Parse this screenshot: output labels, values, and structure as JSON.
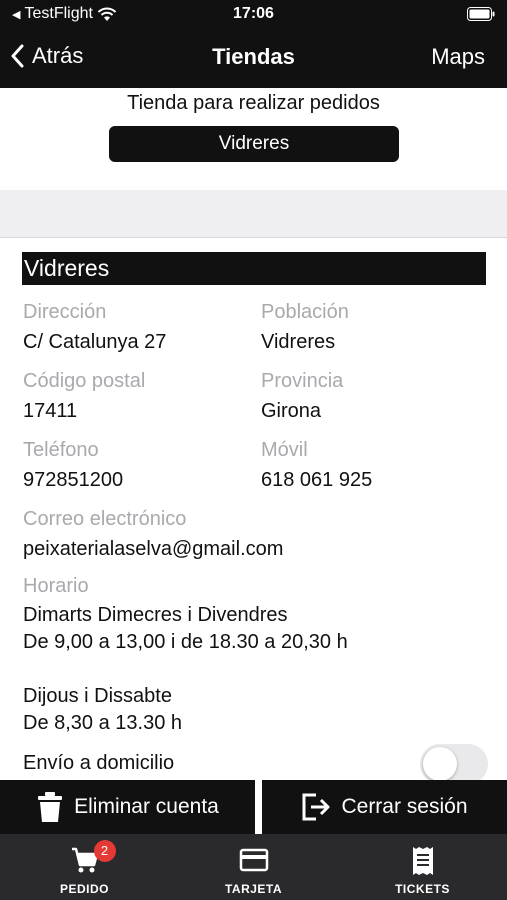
{
  "status_bar": {
    "back_app": "TestFlight",
    "time": "17:06"
  },
  "nav": {
    "back_label": "Atrás",
    "title": "Tiendas",
    "right_label": "Maps"
  },
  "store_selector": {
    "label": "Tienda para realizar pedidos",
    "selected": "Vidreres"
  },
  "store": {
    "name": "Vidreres",
    "fields": {
      "address": {
        "label": "Dirección",
        "value": "C/ Catalunya 27"
      },
      "town": {
        "label": "Población",
        "value": "Vidreres"
      },
      "postal_code": {
        "label": "Código postal",
        "value": "17411"
      },
      "province": {
        "label": "Provincia",
        "value": "Girona"
      },
      "phone": {
        "label": "Teléfono",
        "value": "972851200"
      },
      "mobile": {
        "label": "Móvil",
        "value": "618 061 925"
      },
      "email": {
        "label": "Correo electrónico",
        "value": "peixaterialaselva@gmail.com"
      },
      "schedule": {
        "label": "Horario"
      }
    },
    "schedule_lines": [
      "Dimarts Dimecres i Divendres",
      "De 9,00 a 13,00 i de 18.30 a 20,30 h",
      "",
      "Dijous i Dissabte",
      "De 8,30 a 13.30 h"
    ],
    "home_delivery": {
      "label": "Envío a domicilio",
      "enabled": false
    }
  },
  "actions": {
    "delete_account": "Eliminar cuenta",
    "logout": "Cerrar sesión"
  },
  "tabs": [
    {
      "label": "PEDIDO",
      "icon": "cart-icon",
      "badge": "2"
    },
    {
      "label": "TARJETA",
      "icon": "card-icon"
    },
    {
      "label": "TICKETS",
      "icon": "receipt-icon"
    }
  ],
  "colors": {
    "bar": "#111111",
    "tab_bar": "#2a2a2c",
    "badge": "#e53935",
    "muted_label": "#a9a9ae"
  }
}
